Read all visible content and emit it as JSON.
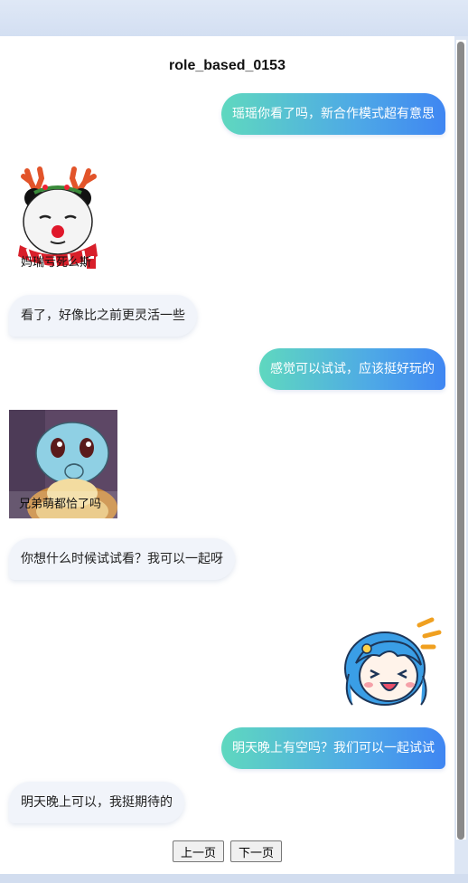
{
  "title": "role_based_0153",
  "messages": [
    {
      "side": "out",
      "text": "瑶瑶你看了吗，新合作模式超有意思"
    },
    {
      "side": "in_sticker",
      "caption": "妈瑞亏死么斯",
      "icon": "panda-reindeer-sticker"
    },
    {
      "side": "in",
      "text": "看了，好像比之前更灵活一些"
    },
    {
      "side": "out",
      "text": "感觉可以试试，应该挺好玩的"
    },
    {
      "side": "in_sticker",
      "caption": "兄弟萌都恰了吗",
      "icon": "squirtle-sticker"
    },
    {
      "side": "in",
      "text": "你想什么时候试试看？我可以一起呀"
    },
    {
      "side": "out_sticker",
      "icon": "blue-hair-laughing-girl-sticker"
    },
    {
      "side": "out",
      "text": "明天晚上有空吗？我们可以一起试试"
    },
    {
      "side": "in",
      "text": "明天晚上可以，我挺期待的"
    }
  ],
  "pager": {
    "prev": "上一页",
    "next": "下一页"
  },
  "colors": {
    "gradient_start": "#5fd8bf",
    "gradient_end": "#3f86f2",
    "incoming_bg": "#f1f4fa"
  }
}
